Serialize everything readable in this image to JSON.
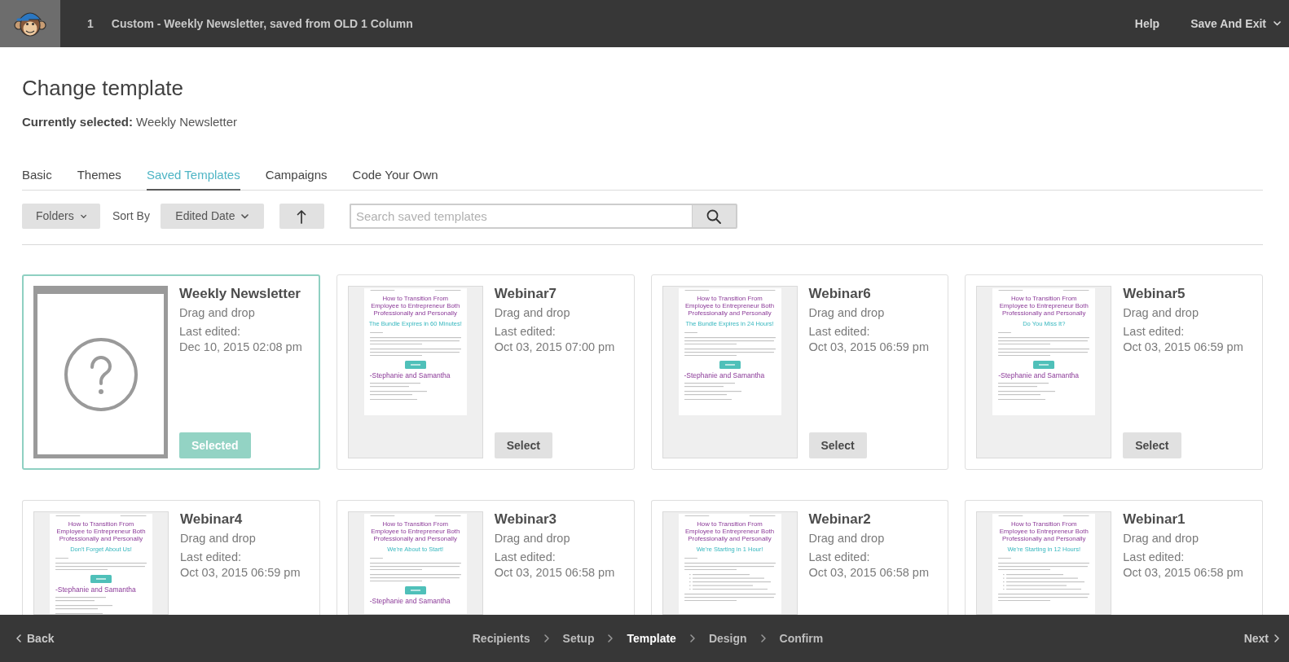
{
  "header": {
    "step": "1",
    "title": "Custom - Weekly Newsletter, saved from OLD 1 Column",
    "links": [
      {
        "label": "Help",
        "kind": "link"
      },
      {
        "label": "Save And Exit",
        "kind": "menu"
      }
    ]
  },
  "page": {
    "title": "Change template",
    "current": "**Currently selected:** Weekly Newsletter"
  },
  "tabs": [
    {
      "label": "Basic",
      "selected": false
    },
    {
      "label": "Themes",
      "selected": false
    },
    {
      "label": "Saved Templates",
      "selected": true
    },
    {
      "label": "Campaigns",
      "selected": false
    },
    {
      "label": "Code Your Own",
      "selected": false
    }
  ],
  "toolbar": {
    "folders": "Folders",
    "sort_label": "Sort By",
    "sort_value": "Edited Date",
    "search": {
      "placeholder": "Search saved templates"
    }
  },
  "templates": [
    {
      "name": "Weekly Newsletter",
      "type": "Drag and drop",
      "edited_label": "Last edited:",
      "edited": "Dec 10, 2015 02:08 pm",
      "selected": true,
      "button": "Selected",
      "thumbnail": {
        "kind": "placeholder"
      }
    },
    {
      "name": "Webinar7",
      "type": "Drag and drop",
      "edited_label": "Last edited:",
      "edited": "Oct 03, 2015 07:00 pm",
      "selected": false,
      "button": "Select",
      "thumbnail": {
        "kind": "email",
        "blocks": [
          {
            "kind": "header"
          },
          {
            "kind": "headline",
            "text": "How to Transition From Employee to Entrepreneur Both Professionally and Personally"
          },
          {
            "kind": "subtitle",
            "text": "The Bundle Expires in 60 Minutes!"
          },
          {
            "kind": "greeting"
          },
          {
            "kind": "paragraph"
          },
          {
            "kind": "paragraph"
          },
          {
            "kind": "button"
          },
          {
            "kind": "signature",
            "text": "-Stephanie and Samantha"
          },
          {
            "kind": "footer"
          }
        ]
      }
    },
    {
      "name": "Webinar6",
      "type": "Drag and drop",
      "edited_label": "Last edited:",
      "edited": "Oct 03, 2015 06:59 pm",
      "selected": false,
      "button": "Select",
      "thumbnail": {
        "kind": "email",
        "blocks": [
          {
            "kind": "header"
          },
          {
            "kind": "headline",
            "text": "How to Transition From Employee to Entrepreneur Both Professionally and Personally"
          },
          {
            "kind": "subtitle",
            "text": "The Bundle Expires in 24 Hours!"
          },
          {
            "kind": "greeting"
          },
          {
            "kind": "paragraph"
          },
          {
            "kind": "paragraph"
          },
          {
            "kind": "button"
          },
          {
            "kind": "signature",
            "text": "-Stephanie and Samantha"
          },
          {
            "kind": "footer"
          }
        ]
      }
    },
    {
      "name": "Webinar5",
      "type": "Drag and drop",
      "edited_label": "Last edited:",
      "edited": "Oct 03, 2015 06:59 pm",
      "selected": false,
      "button": "Select",
      "thumbnail": {
        "kind": "email",
        "blocks": [
          {
            "kind": "header"
          },
          {
            "kind": "headline",
            "text": "How to Transition From Employee to Entrepreneur Both Professionally and Personally"
          },
          {
            "kind": "subtitle",
            "text": "Do You Miss It?"
          },
          {
            "kind": "greeting"
          },
          {
            "kind": "paragraph"
          },
          {
            "kind": "paragraph"
          },
          {
            "kind": "button"
          },
          {
            "kind": "signature",
            "text": "-Stephanie and Samantha"
          },
          {
            "kind": "footer"
          }
        ]
      }
    },
    {
      "name": "Webinar4",
      "type": "Drag and drop",
      "edited_label": "Last edited:",
      "edited": "Oct 03, 2015 06:59 pm",
      "selected": false,
      "thumbnail": {
        "kind": "email",
        "blocks": [
          {
            "kind": "header"
          },
          {
            "kind": "headline",
            "text": "How to Transition From Employee to Entrepreneur Both Professionally and Personally"
          },
          {
            "kind": "subtitle",
            "text": "Don't Forget About Us!"
          },
          {
            "kind": "greeting"
          },
          {
            "kind": "paragraph"
          },
          {
            "kind": "button"
          },
          {
            "kind": "signature",
            "text": "-Stephanie and Samantha"
          },
          {
            "kind": "footer"
          }
        ]
      }
    },
    {
      "name": "Webinar3",
      "type": "Drag and drop",
      "edited_label": "Last edited:",
      "edited": "Oct 03, 2015 06:58 pm",
      "selected": false,
      "thumbnail": {
        "kind": "email",
        "blocks": [
          {
            "kind": "header"
          },
          {
            "kind": "headline",
            "text": "How to Transition From Employee to Entrepreneur Both Professionally and Personally"
          },
          {
            "kind": "subtitle",
            "text": "We're About to Start!"
          },
          {
            "kind": "greeting"
          },
          {
            "kind": "paragraph"
          },
          {
            "kind": "paragraph"
          },
          {
            "kind": "button"
          },
          {
            "kind": "signature",
            "text": "-Stephanie and Samantha"
          }
        ]
      }
    },
    {
      "name": "Webinar2",
      "type": "Drag and drop",
      "edited_label": "Last edited:",
      "edited": "Oct 03, 2015 06:58 pm",
      "selected": false,
      "thumbnail": {
        "kind": "email",
        "blocks": [
          {
            "kind": "header"
          },
          {
            "kind": "headline",
            "text": "How to Transition From Employee to Entrepreneur Both Professionally and Personally"
          },
          {
            "kind": "subtitle",
            "text": "We're Starting in 1 Hour!"
          },
          {
            "kind": "greeting"
          },
          {
            "kind": "paragraph"
          },
          {
            "kind": "bullets"
          },
          {
            "kind": "paragraph"
          }
        ]
      }
    },
    {
      "name": "Webinar1",
      "type": "Drag and drop",
      "edited_label": "Last edited:",
      "edited": "Oct 03, 2015 06:58 pm",
      "selected": false,
      "thumbnail": {
        "kind": "email",
        "blocks": [
          {
            "kind": "header"
          },
          {
            "kind": "headline",
            "text": "How to Transition From Employee to Entrepreneur Both Professionally and Personally"
          },
          {
            "kind": "subtitle",
            "text": "We're Starting in 12 Hours!"
          },
          {
            "kind": "greeting"
          },
          {
            "kind": "paragraph"
          },
          {
            "kind": "bullets"
          },
          {
            "kind": "paragraph"
          }
        ]
      }
    }
  ],
  "footer": {
    "back": "Back",
    "steps": [
      {
        "label": "Recipients",
        "selected": false
      },
      {
        "label": "Setup",
        "selected": false
      },
      {
        "label": "Template",
        "selected": true
      },
      {
        "label": "Design",
        "selected": false
      },
      {
        "label": "Confirm",
        "selected": false
      }
    ],
    "next": "Next"
  }
}
